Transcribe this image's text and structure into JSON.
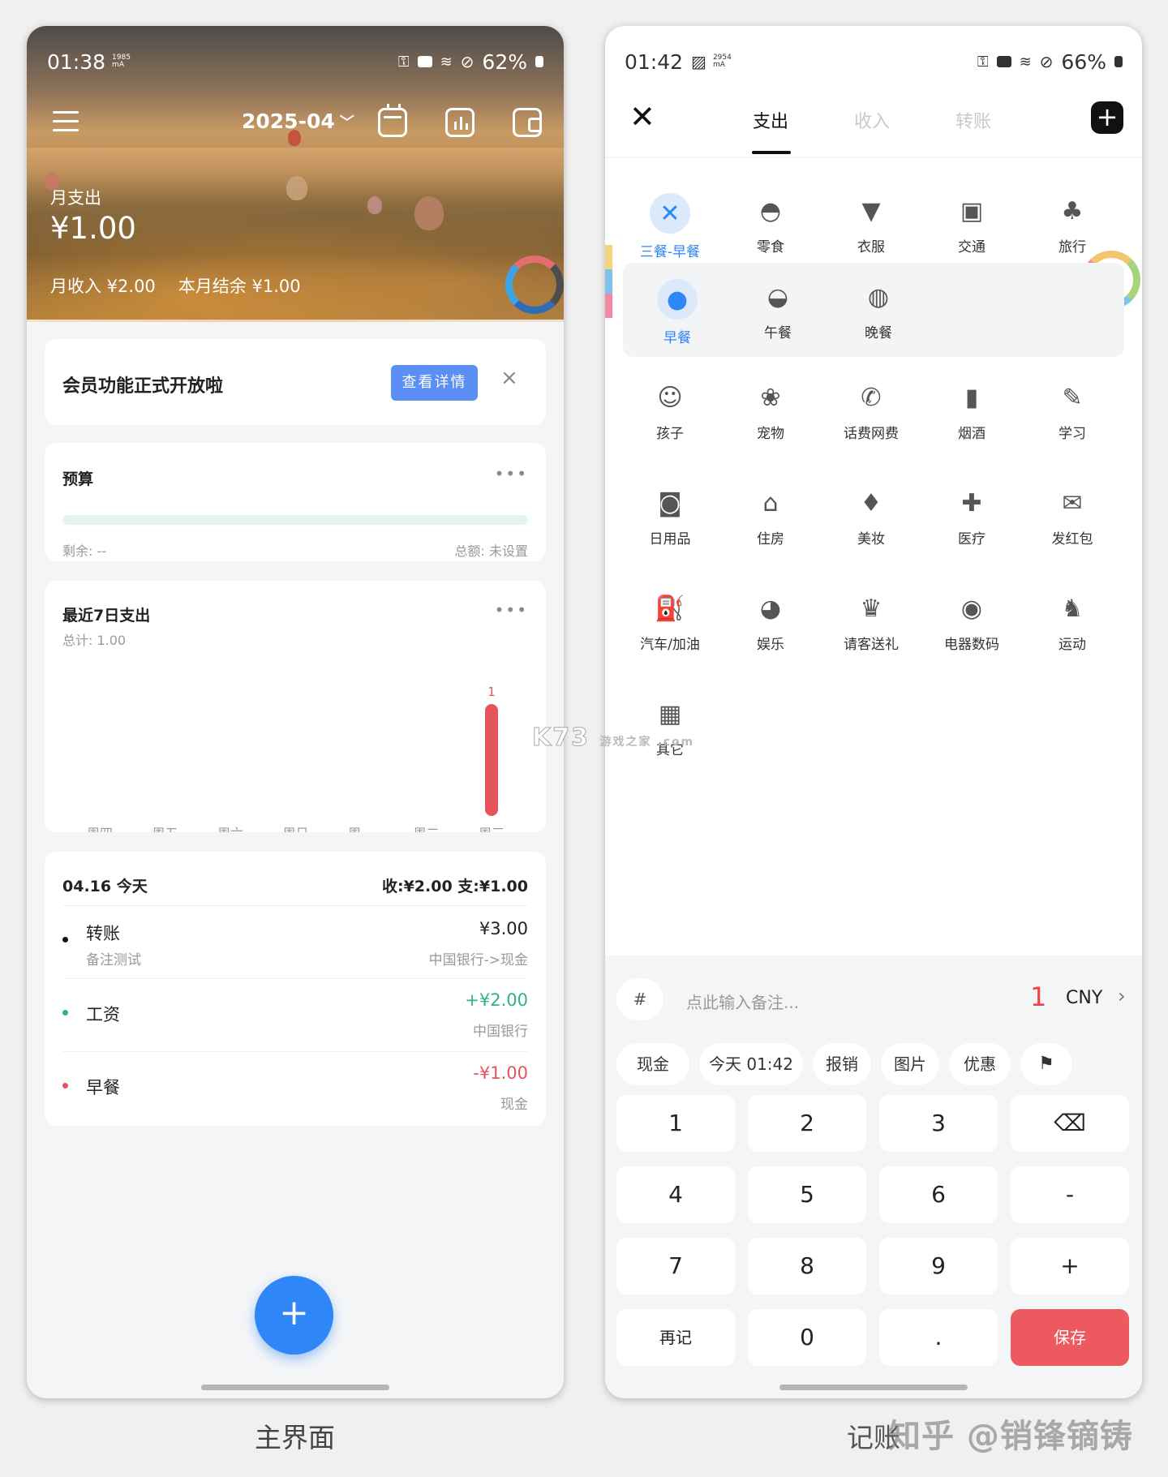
{
  "main": {
    "status": {
      "time": "01:38",
      "mah_top": "1985",
      "mah_bottom": "mA",
      "battery": "62%"
    },
    "month": "2025-04",
    "hero": {
      "label": "月支出",
      "amount": "¥1.00",
      "income": "月收入 ¥2.00",
      "balance": "本月结余 ¥1.00"
    },
    "banner": {
      "text": "会员功能正式开放啦",
      "button": "查看详情",
      "close": "×"
    },
    "budget": {
      "title": "预算",
      "more": "•••",
      "remaining": "剩余: --",
      "total": "总额: 未设置",
      "progress": 0
    },
    "week": {
      "title": "最近7日支出",
      "more": "•••",
      "total": "总计: 1.00"
    },
    "day": {
      "header": "04.16 今天",
      "summary": "收:¥2.00 支:¥1.00",
      "records": [
        {
          "name": "转账",
          "note": "备注测试",
          "amount": "¥3.00",
          "account": "中国银行->现金",
          "color": "#111111"
        },
        {
          "name": "工资",
          "note": "",
          "amount": "+¥2.00",
          "account": "中国银行",
          "color": "#2eb57a"
        },
        {
          "name": "早餐",
          "note": "",
          "amount": "-¥1.00",
          "account": "现金",
          "color": "#e5535b"
        }
      ]
    },
    "fab": "+",
    "caption": "主界面"
  },
  "chart_data": {
    "type": "bar",
    "categories": [
      "周四",
      "周五",
      "周六",
      "周日",
      "周一",
      "周二",
      "周三"
    ],
    "values": [
      0,
      0,
      0,
      0,
      0,
      0,
      1
    ],
    "data_labels": [
      "",
      "",
      "",
      "",
      "",
      "",
      "1"
    ],
    "bar_color": "#e5535b",
    "title": "最近7日支出",
    "subtitle": "总计: 1.00"
  },
  "entry": {
    "status": {
      "time": "01:42",
      "mah_top": "2954",
      "mah_bottom": "mA",
      "battery": "66%"
    },
    "close": "✕",
    "tabs": [
      {
        "label": "支出",
        "active": true
      },
      {
        "label": "收入",
        "active": false
      },
      {
        "label": "转账",
        "active": false
      }
    ],
    "add": "+",
    "categories_row1": [
      {
        "label": "三餐-早餐",
        "icon": "meal-icon",
        "glyph": "✕",
        "active": true
      },
      {
        "label": "零食",
        "icon": "snack-icon",
        "glyph": "◓"
      },
      {
        "label": "衣服",
        "icon": "shirt-icon",
        "glyph": "▼"
      },
      {
        "label": "交通",
        "icon": "bus-icon",
        "glyph": "▣"
      },
      {
        "label": "旅行",
        "icon": "palm-tree-icon",
        "glyph": "♣"
      }
    ],
    "subcategories": [
      {
        "label": "早餐",
        "icon": "breakfast-icon",
        "glyph": "●",
        "active": true
      },
      {
        "label": "午餐",
        "icon": "lunch-icon",
        "glyph": "◒"
      },
      {
        "label": "晚餐",
        "icon": "dinner-icon",
        "glyph": "◍"
      }
    ],
    "categories_rest": [
      {
        "label": "孩子",
        "icon": "child-icon",
        "glyph": "☺"
      },
      {
        "label": "宠物",
        "icon": "paw-icon",
        "glyph": "❀"
      },
      {
        "label": "话费网费",
        "icon": "phone-icon",
        "glyph": "✆"
      },
      {
        "label": "烟酒",
        "icon": "bottle-icon",
        "glyph": "▮"
      },
      {
        "label": "学习",
        "icon": "study-icon",
        "glyph": "✎"
      },
      {
        "label": "日用品",
        "icon": "daily-goods-icon",
        "glyph": "◙"
      },
      {
        "label": "住房",
        "icon": "house-icon",
        "glyph": "⌂"
      },
      {
        "label": "美妆",
        "icon": "makeup-icon",
        "glyph": "♦"
      },
      {
        "label": "医疗",
        "icon": "medical-icon",
        "glyph": "✚"
      },
      {
        "label": "发红包",
        "icon": "red-envelope-icon",
        "glyph": "✉"
      },
      {
        "label": "汽车/加油",
        "icon": "fuel-icon",
        "glyph": "⛽"
      },
      {
        "label": "娱乐",
        "icon": "entertainment-icon",
        "glyph": "◕"
      },
      {
        "label": "请客送礼",
        "icon": "gift-icon",
        "glyph": "♛"
      },
      {
        "label": "电器数码",
        "icon": "camera-icon",
        "glyph": "◉"
      },
      {
        "label": "运动",
        "icon": "running-icon",
        "glyph": "♞"
      },
      {
        "label": "其它",
        "icon": "grid-icon",
        "glyph": "▦"
      }
    ],
    "note": {
      "hash": "#",
      "placeholder": "点此输入备注...",
      "amount": "1",
      "currency": "CNY",
      "chevron": "›"
    },
    "chips": [
      "现金",
      "今天 01:42",
      "报销",
      "图片",
      "优惠"
    ],
    "keys": [
      "1",
      "2",
      "3",
      "⌫",
      "4",
      "5",
      "6",
      "-",
      "7",
      "8",
      "9",
      "+",
      "再记",
      "0",
      ".",
      "保存"
    ],
    "caption": "记账",
    "watermark": "知乎 @销锋镝铸",
    "k73": "K73",
    "k73_sub": "游戏之家 .com"
  }
}
